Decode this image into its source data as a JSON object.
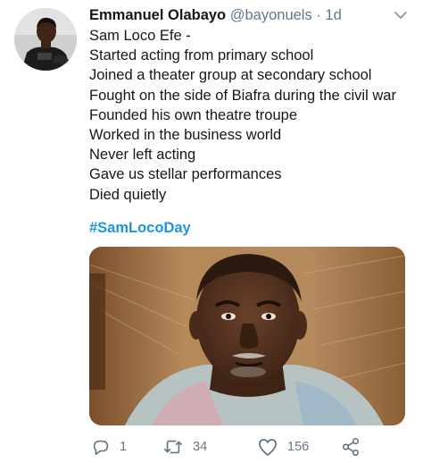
{
  "tweet": {
    "author_name": "Emmanuel Olabayo",
    "author_handle": "@bayonuels",
    "separator": "·",
    "timestamp": "1d",
    "lines": [
      "Sam Loco Efe -",
      "Started acting from primary school",
      "Joined a theater group at secondary school",
      "Fought on the side of Biafra during the civil war",
      "Founded his own theatre troupe",
      "Worked in the business world",
      "Never left acting",
      "Gave us stellar performances",
      "Died quietly"
    ],
    "hashtag": "#SamLocoDay"
  },
  "actions": {
    "reply_count": "1",
    "retweet_count": "34",
    "like_count": "156"
  },
  "icons": {
    "caret": "chevron-down-icon",
    "reply": "reply-icon",
    "retweet": "retweet-icon",
    "like": "heart-icon",
    "share": "share-icon"
  },
  "colors": {
    "text": "#14171a",
    "secondary": "#657786",
    "link": "#1b95e0"
  }
}
